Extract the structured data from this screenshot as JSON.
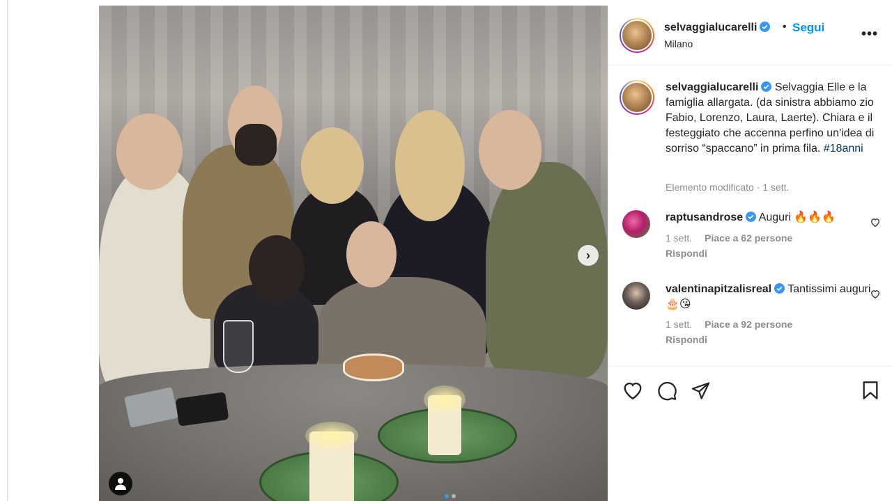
{
  "post_header": {
    "username": "selvaggialucarelli",
    "separator": "•",
    "follow_label": "Segui",
    "location": "Milano",
    "more_label": "•••"
  },
  "caption": {
    "username": "selvaggialucarelli",
    "text": "Selvaggia Elle e la famiglia allargata. (da sinistra abbiamo zio Fabio, Lorenzo, Laura, Laerte). Chiara e il festeggiato che accenna perfino un'idea di sorriso “spaccano” in prima fila.",
    "hashtag": "#18anni",
    "meta": "Elemento modificato · 1 sett."
  },
  "comments": [
    {
      "username": "raptusandrose",
      "text": "Auguri 🔥🔥🔥",
      "time": "1 sett.",
      "likes": "Piace a 62 persone",
      "reply_label": "Rispondi"
    },
    {
      "username": "valentinapitzalisreal",
      "text": "Tantissimi auguri🎂😘",
      "time": "1 sett.",
      "likes": "Piace a 92 persone",
      "reply_label": "Rispondi"
    }
  ],
  "colors": {
    "accent": "#0095f6",
    "verified": "#3897f0",
    "muted": "#8e8e8e",
    "hashtag": "#00376b"
  },
  "icons": [
    "verified-badge-icon",
    "more-options-icon",
    "next-arrow-icon",
    "user-tag-icon",
    "like-heart-icon",
    "comment-icon",
    "share-icon",
    "save-bookmark-icon",
    "comment-like-icon"
  ]
}
